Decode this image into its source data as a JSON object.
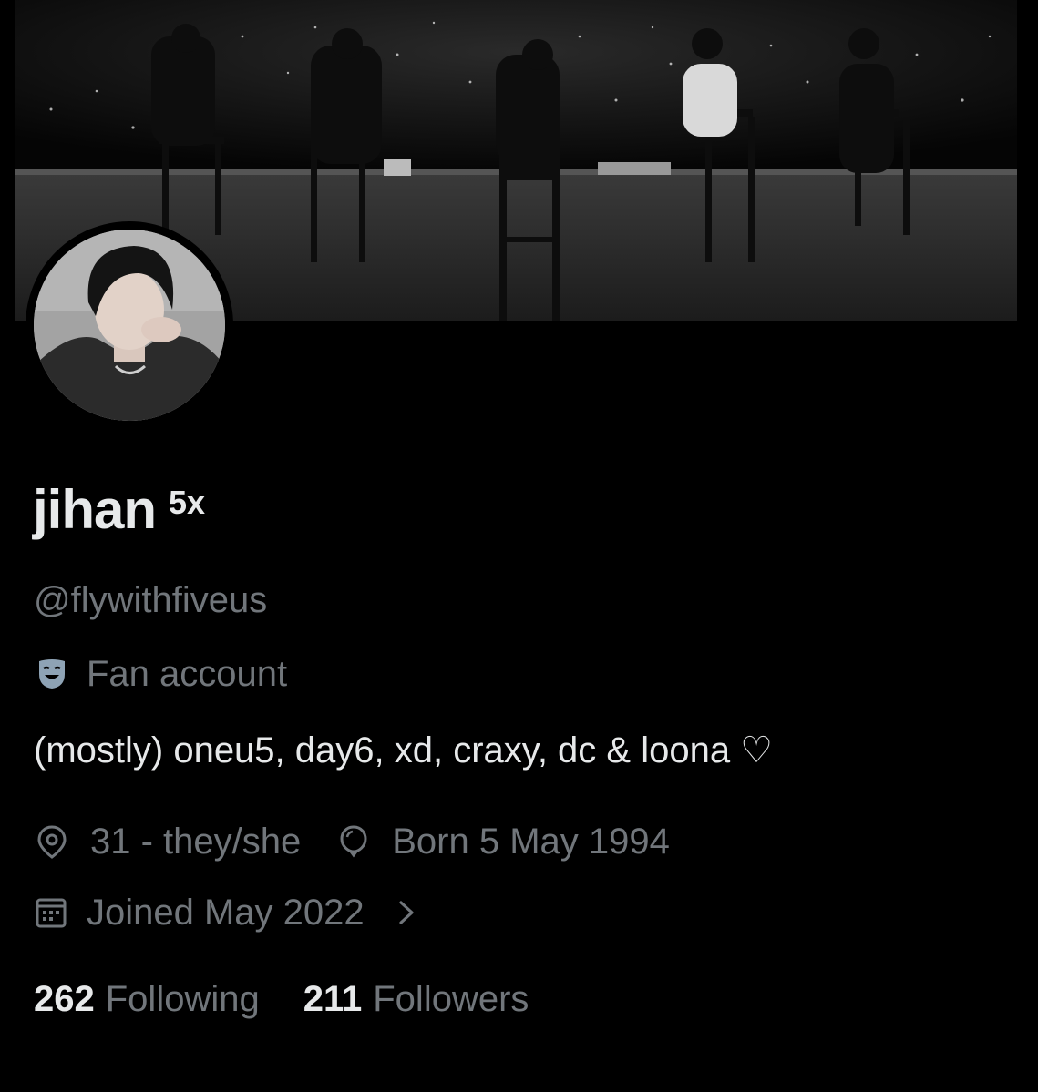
{
  "profile": {
    "display_name": "jihan",
    "name_badge": "5x",
    "handle": "@flywithfiveus",
    "category": "Fan account",
    "bio": "(mostly) oneu5, day6, xd, craxy, dc & loona ♡",
    "location": "31 - they/she",
    "birthday": "Born 5 May 1994",
    "joined": "Joined May 2022"
  },
  "stats": {
    "following_count": "262",
    "following_label": "Following",
    "followers_count": "211",
    "followers_label": "Followers"
  },
  "icons": {
    "category": "theater-mask-icon",
    "location": "location-pin-icon",
    "birthday": "balloon-icon",
    "joined": "calendar-icon",
    "joined_more": "chevron-right-icon"
  },
  "colors": {
    "background": "#000000",
    "primary_text": "#e7e9ea",
    "secondary_text": "#71767b",
    "mask_icon": "#8ea3b5"
  }
}
